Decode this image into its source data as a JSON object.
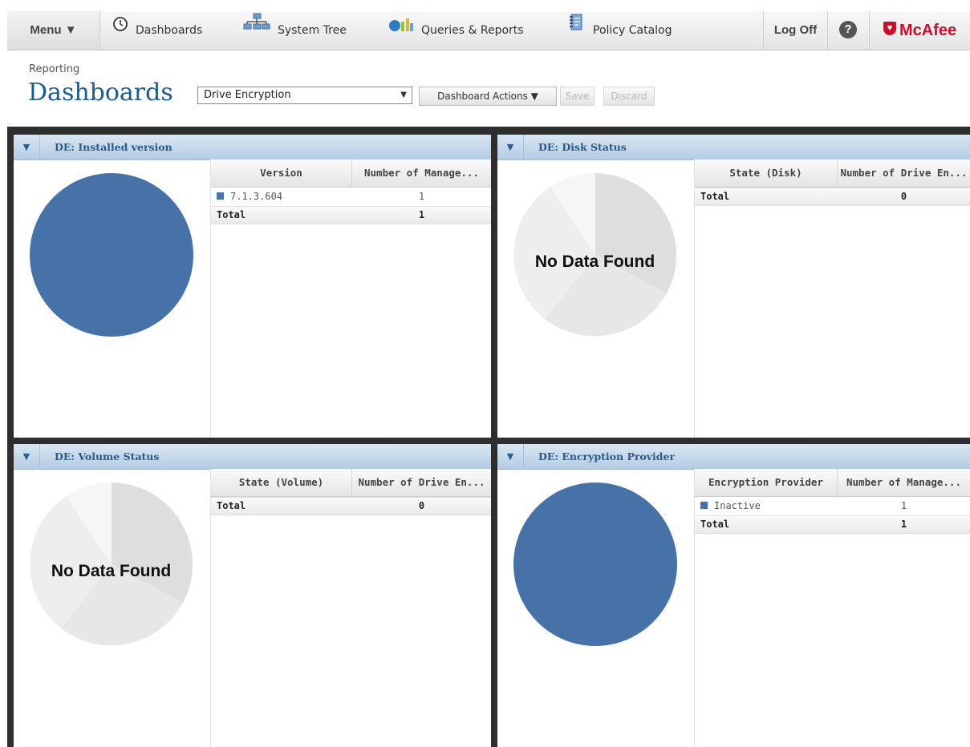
{
  "nav": {
    "menu_label": "Menu ▼",
    "items": [
      {
        "label": "Dashboards",
        "icon": "clock-icon"
      },
      {
        "label": "System Tree",
        "icon": "network-icon"
      },
      {
        "label": "Queries & Reports",
        "icon": "chart-icon"
      },
      {
        "label": "Policy Catalog",
        "icon": "notebook-icon"
      }
    ],
    "logoff_label": "Log Off",
    "help_glyph": "?",
    "brand_label": "McAfee"
  },
  "page": {
    "breadcrumb": "Reporting",
    "title": "Dashboards",
    "selected_dashboard": "Drive Encryption",
    "actions_label": "Dashboard Actions ▼",
    "save_label": "Save",
    "discard_label": "Discard"
  },
  "colors": {
    "accent": "#4672a8",
    "title_blue": "#1d5a8f",
    "brand_red": "#c8102e",
    "no_data_greys": [
      "#dedede",
      "#e7e7e7",
      "#eeeeee",
      "#f6f6f6"
    ]
  },
  "panels": [
    {
      "title": "DE: Installed version",
      "columns": [
        "Version",
        "Number of Manage..."
      ],
      "rows": [
        {
          "label": "7.1.3.604",
          "value": "1"
        }
      ],
      "total_label": "Total",
      "total_value": "1",
      "no_data": null
    },
    {
      "title": "DE: Disk Status",
      "columns": [
        "State (Disk)",
        "Number of Drive En..."
      ],
      "rows": [],
      "total_label": "Total",
      "total_value": "0",
      "no_data": "No Data Found"
    },
    {
      "title": "DE: Volume Status",
      "columns": [
        "State (Volume)",
        "Number of Drive En..."
      ],
      "rows": [],
      "total_label": "Total",
      "total_value": "0",
      "no_data": "No Data Found"
    },
    {
      "title": "DE: Encryption Provider",
      "columns": [
        "Encryption Provider",
        "Number of Manage..."
      ],
      "rows": [
        {
          "label": "Inactive",
          "value": "1"
        }
      ],
      "total_label": "Total",
      "total_value": "1",
      "no_data": null
    }
  ],
  "chart_data": [
    {
      "type": "pie",
      "categories": [
        "7.1.3.604"
      ],
      "values": [
        1
      ]
    },
    {
      "type": "pie",
      "categories": [],
      "values": []
    },
    {
      "type": "pie",
      "categories": [],
      "values": []
    },
    {
      "type": "pie",
      "categories": [
        "Inactive"
      ],
      "values": [
        1
      ]
    }
  ]
}
